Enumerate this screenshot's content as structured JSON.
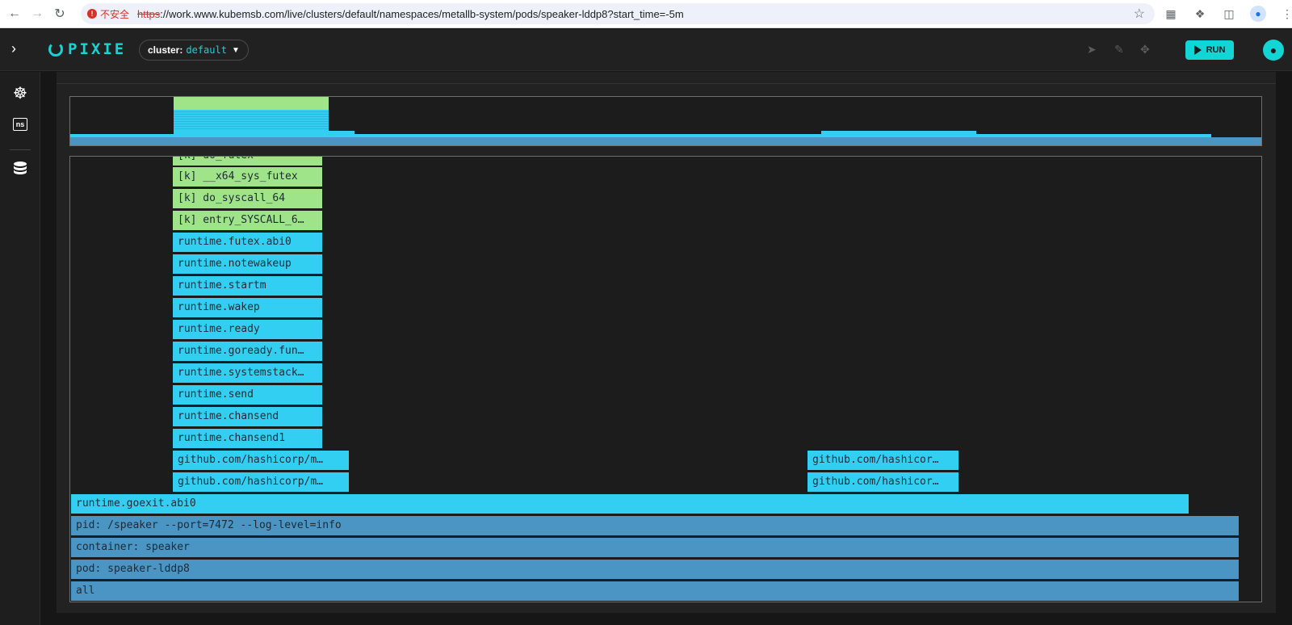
{
  "browser": {
    "security_label": "不安全",
    "url_scheme": "https",
    "url_rest": "://work.www.kubemsb.com/live/clusters/default/namespaces/metallb-system/pods/speaker-lddp8?start_time=-5m"
  },
  "header": {
    "logo_text": "PIXIE",
    "cluster_label": "cluster:",
    "cluster_value": "default",
    "run_label": "RUN"
  },
  "flamegraph": {
    "frames": [
      {
        "label": "[k] do_futex"
      },
      {
        "label": "[k] __x64_sys_futex"
      },
      {
        "label": "[k] do_syscall_64"
      },
      {
        "label": "[k] entry_SYSCALL_6…"
      },
      {
        "label": "runtime.futex.abi0"
      },
      {
        "label": "runtime.notewakeup"
      },
      {
        "label": "runtime.startm"
      },
      {
        "label": "runtime.wakep"
      },
      {
        "label": "runtime.ready"
      },
      {
        "label": "runtime.goready.fun…"
      },
      {
        "label": "runtime.systemstack…"
      },
      {
        "label": "runtime.send"
      },
      {
        "label": "runtime.chansend"
      },
      {
        "label": "runtime.chansend1"
      },
      {
        "label": "github.com/hashicorp/m…"
      },
      {
        "label": "github.com/hashicorp/m…"
      },
      {
        "label": "github.com/hashicor…"
      },
      {
        "label": "github.com/hashicor…"
      },
      {
        "label": "runtime.goexit.abi0"
      },
      {
        "label": "pid: /speaker --port=7472 --log-level=info"
      },
      {
        "label": "container: speaker"
      },
      {
        "label": "pod: speaker-lddp8"
      },
      {
        "label": "all"
      }
    ]
  },
  "colors": {
    "accent": "#12d6d6",
    "kernel_frame": "#a0e48a",
    "user_frame": "#33cff2",
    "base_frame": "#4a95c4"
  }
}
